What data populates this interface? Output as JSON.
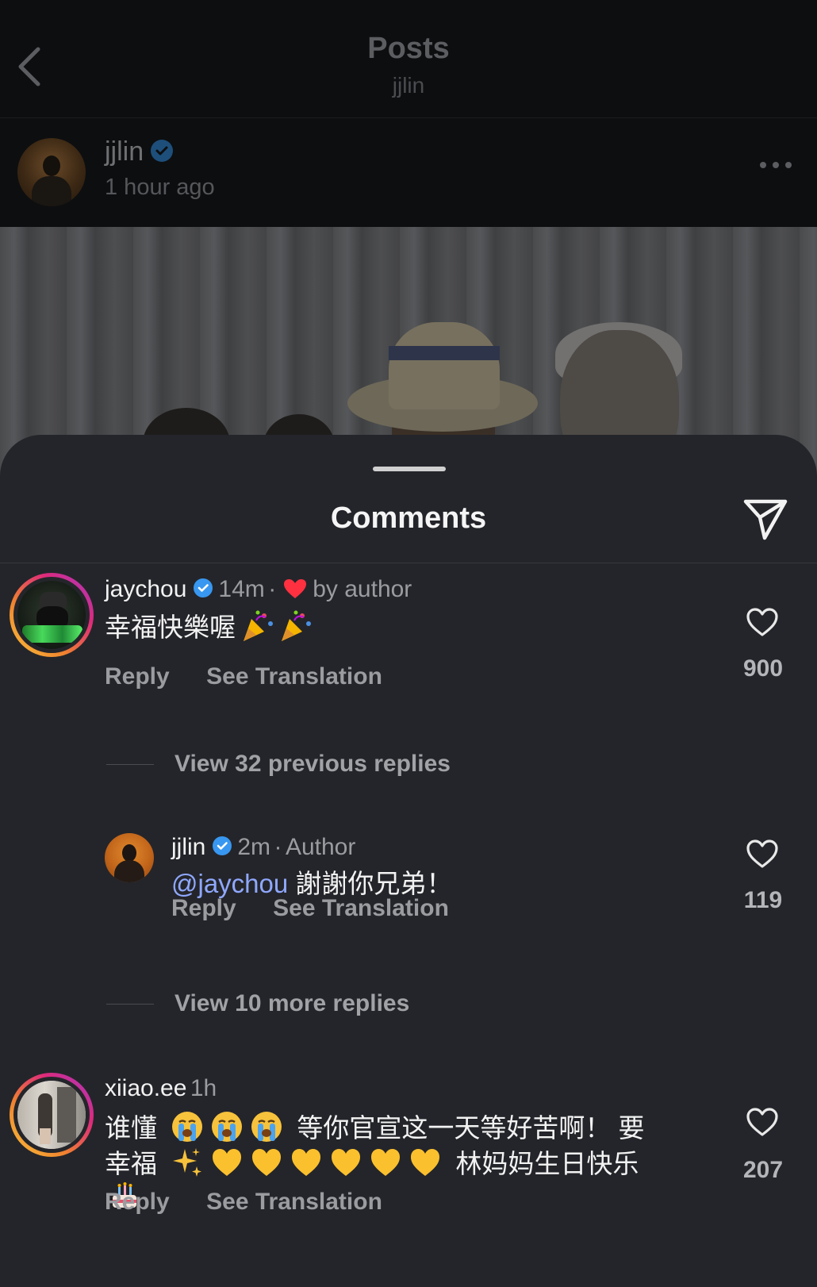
{
  "topbar": {
    "title": "Posts",
    "subtitle": "jjlin"
  },
  "post": {
    "username": "jjlin",
    "time": "1 hour ago"
  },
  "sheet": {
    "title": "Comments"
  },
  "comments": [
    {
      "username": "jaychou",
      "time": "14m",
      "separator": "·",
      "liked_by": "by author",
      "text": "幸福快樂喔",
      "emojis": [
        "party-popper",
        "party-popper"
      ],
      "reply_label": "Reply",
      "translate_label": "See Translation",
      "likes": "900"
    },
    {
      "username": "xiiao.ee",
      "time": "1h",
      "text_line1": "谁懂 😭😭😭 等你官宣这一天等好苦啊！ 要",
      "text_line1_a": "谁懂",
      "text_line1_b": "等你官宣这一天等好苦啊！ 要",
      "text_line2_a": "幸福",
      "text_line2_b": "林妈妈生日快乐",
      "reply_label": "Reply",
      "translate_label": "See Translation",
      "likes": "207"
    }
  ],
  "view_previous": "View 32 previous replies",
  "reply": {
    "username": "jjlin",
    "time": "2m",
    "separator": "·",
    "role": "Author",
    "mention": "@jaychou",
    "text": "謝謝你兄弟！",
    "reply_label": "Reply",
    "translate_label": "See Translation",
    "likes": "119"
  },
  "view_more": "View 10 more replies",
  "colors": {
    "sheet_bg": "#24252a",
    "verified": "#3897f0",
    "mention": "#8fa8ff",
    "heart_red": "#ff3040"
  },
  "icons": [
    "back-icon",
    "verified-icon",
    "more-icon",
    "share-icon",
    "heart-icon",
    "party-popper-emoji",
    "crying-emoji",
    "sparkles-emoji",
    "yellow-heart-emoji",
    "cake-emoji"
  ]
}
